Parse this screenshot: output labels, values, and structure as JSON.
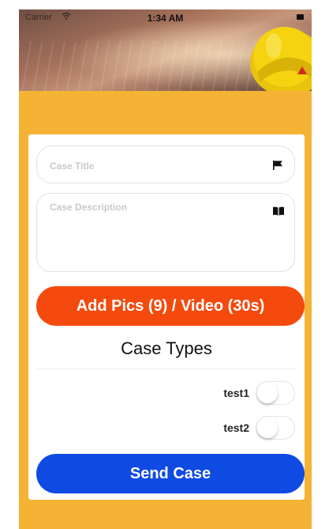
{
  "status_bar": {
    "carrier": "Carrier",
    "time": "1:34 AM"
  },
  "form": {
    "title_placeholder": "Case Title",
    "description_placeholder": "Case Description",
    "add_media_label": "Add Pics (9) / Video (30s)",
    "case_types_title": "Case Types",
    "case_types": [
      {
        "label": "test1",
        "enabled": false
      },
      {
        "label": "test2",
        "enabled": false
      }
    ],
    "send_label": "Send Case"
  },
  "colors": {
    "background": "#f4b334",
    "add_media_button": "#f44a0e",
    "send_button": "#0f4ae3",
    "helmet": "#f5d310"
  },
  "icons": {
    "title_field": "flag-icon",
    "description_field": "book-icon",
    "header_image": "helmet-icon",
    "wifi": "wifi-icon",
    "battery": "battery-icon"
  }
}
